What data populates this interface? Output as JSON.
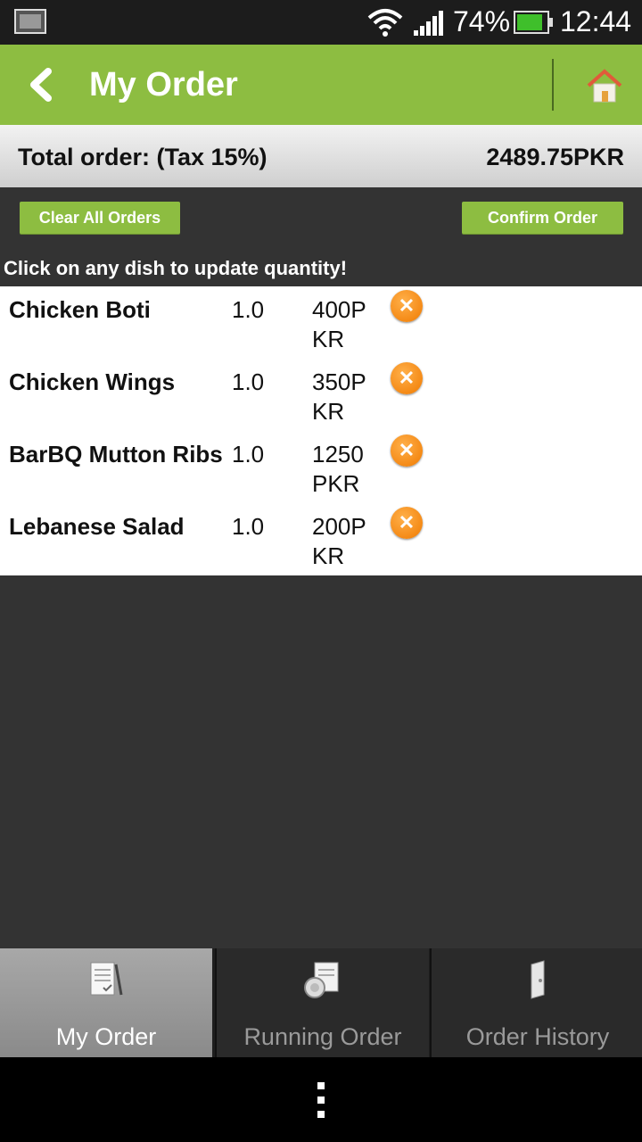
{
  "status_bar": {
    "battery_percent": "74%",
    "time": "12:44",
    "battery_color": "#3fbf2b"
  },
  "header": {
    "title": "My Order",
    "back_icon": "chevron-left-icon",
    "home_icon": "home-icon",
    "accent_color": "#8dbd41"
  },
  "total": {
    "label": "Total order: (Tax 15%)",
    "value": "2489.75PKR"
  },
  "actions": {
    "clear_label": "Clear All Orders",
    "confirm_label": "Confirm Order"
  },
  "hint": "Click on any dish to update quantity!",
  "orders": [
    {
      "name": "Chicken Boti",
      "qty": "1.0",
      "price": "400PKR"
    },
    {
      "name": "Chicken Wings",
      "qty": "1.0",
      "price": "350PKR"
    },
    {
      "name": "BarBQ Mutton Ribs",
      "qty": "1.0",
      "price": "1250 PKR"
    },
    {
      "name": "Lebanese Salad",
      "qty": "1.0",
      "price": "200PKR"
    }
  ],
  "tabs": [
    {
      "label": "My Order",
      "icon": "order-document-icon",
      "active": true
    },
    {
      "label": "Running Order",
      "icon": "running-order-icon",
      "active": false
    },
    {
      "label": "Order History",
      "icon": "order-history-icon",
      "active": false
    }
  ]
}
